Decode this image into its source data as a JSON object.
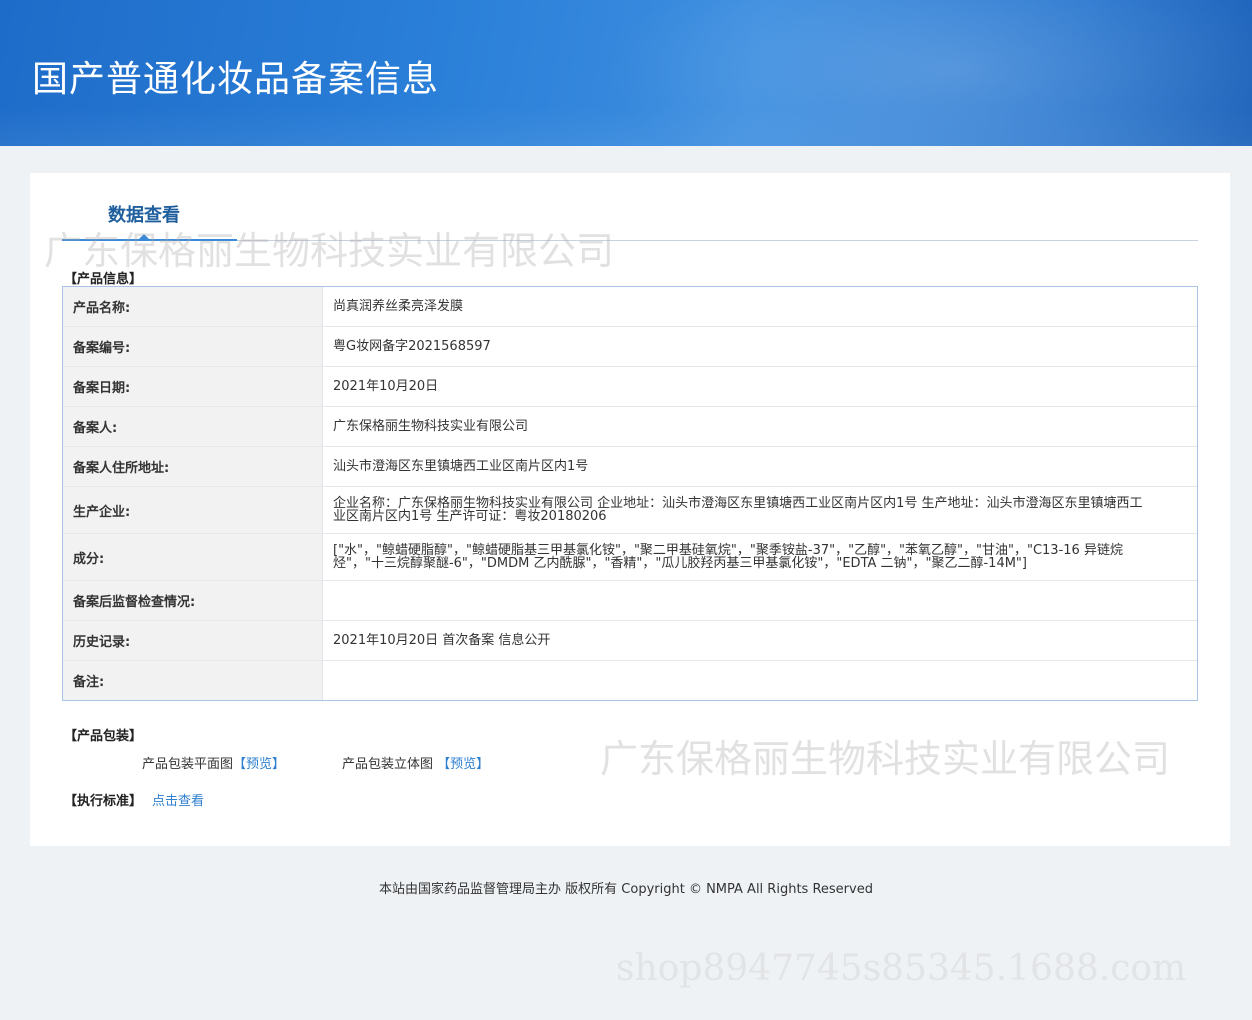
{
  "header": {
    "title": "国产普通化妆品备案信息"
  },
  "tab": {
    "label": "数据查看"
  },
  "sections": {
    "product_info": "【产品信息】",
    "packaging": "【产品包装】",
    "standard": "【执行标准】"
  },
  "rows": [
    {
      "key": "产品名称:",
      "value": "尚真润养丝柔亮泽发膜"
    },
    {
      "key": "备案编号:",
      "value": "粤G妆网备字2021568597"
    },
    {
      "key": "备案日期:",
      "value": "2021年10月20日"
    },
    {
      "key": "备案人:",
      "value": "广东保格丽生物科技实业有限公司"
    },
    {
      "key": "备案人住所地址:",
      "value": "汕头市澄海区东里镇塘西工业区南片区内1号"
    },
    {
      "key": "生产企业:",
      "value": "企业名称：广东保格丽生物科技实业有限公司 企业地址：汕头市澄海区东里镇塘西工业区南片区内1号 生产地址：汕头市澄海区东里镇塘西工业区南片区内1号 生产许可证：粤妆20180206"
    },
    {
      "key": "成分:",
      "value": "[\"水\"，\"鲸蜡硬脂醇\"，\"鲸蜡硬脂基三甲基氯化铵\"，\"聚二甲基硅氧烷\"，\"聚季铵盐-37\"，\"乙醇\"，\"苯氧乙醇\"，\"甘油\"，\"C13-16 异链烷烃\"，\"十三烷醇聚醚-6\"，\"DMDM 乙内酰脲\"，\"香精\"，\"瓜儿胶羟丙基三甲基氯化铵\"，\"EDTA 二钠\"，\"聚乙二醇-14M\"]"
    },
    {
      "key": "备案后监督检查情况:",
      "value": ""
    },
    {
      "key": "历史记录:",
      "value": "2021年10月20日 首次备案 信息公开"
    },
    {
      "key": "备注:",
      "value": ""
    }
  ],
  "packaging": {
    "flat_label": "产品包装平面图",
    "flat_link": "【预览】",
    "solid_label": "产品包装立体图",
    "solid_link": "【预览】"
  },
  "standard": {
    "link": "点击查看"
  },
  "footer": {
    "text": "本站由国家药品监督管理局主办 版权所有 Copyright © NMPA All Rights Reserved"
  },
  "watermarks": {
    "top": "广东保格丽生物科技实业有限公司",
    "middle": "广东保格丽生物科技实业有限公司",
    "bottom": "shop8947745s85345.1688.com"
  }
}
